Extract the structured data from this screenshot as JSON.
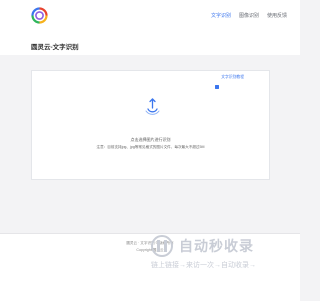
{
  "header": {
    "nav": [
      {
        "label": "文字识别",
        "active": true
      },
      {
        "label": "图像识别",
        "active": false
      },
      {
        "label": "使用反馈",
        "active": false
      }
    ]
  },
  "page": {
    "title": "圆灵云-文字识别"
  },
  "card": {
    "tag": "文字识别教程",
    "upload_title": "点击选择图片进行识别",
    "upload_hint": "注意：目前支持jpg、jpg等常见格式的图片文件，每次最大不超过5M"
  },
  "footer": {
    "line1": "圆灵云 · 文字识别 © 版权所有",
    "line2": "Copyright 圆灵云"
  },
  "watermark": {
    "title": "自动秒收录",
    "subtitle": "链上链接→来访一次→自动收录→"
  },
  "colors": {
    "accent": "#3b76ee",
    "background": "#f3f3f5"
  }
}
